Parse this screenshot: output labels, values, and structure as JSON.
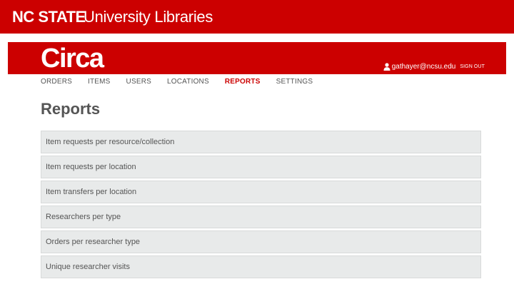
{
  "site_header": {
    "brand_strong": "NC STATE",
    "brand_light": "University Libraries",
    "color": "#cc0000"
  },
  "app_header": {
    "logo": "Circa",
    "user_email": "gathayer@ncsu.edu",
    "sign_out": "SIGN OUT",
    "user_icon": "user-icon"
  },
  "nav": {
    "items": [
      {
        "label": "ORDERS"
      },
      {
        "label": "ITEMS"
      },
      {
        "label": "USERS"
      },
      {
        "label": "LOCATIONS"
      },
      {
        "label": "REPORTS",
        "active": true
      },
      {
        "label": "SETTINGS"
      }
    ]
  },
  "page": {
    "title": "Reports"
  },
  "reports": [
    {
      "label": "Item requests per resource/collection"
    },
    {
      "label": "Item requests per location"
    },
    {
      "label": "Item transfers per location"
    },
    {
      "label": "Researchers per type"
    },
    {
      "label": "Orders per researcher type"
    },
    {
      "label": "Unique researcher visits"
    }
  ]
}
